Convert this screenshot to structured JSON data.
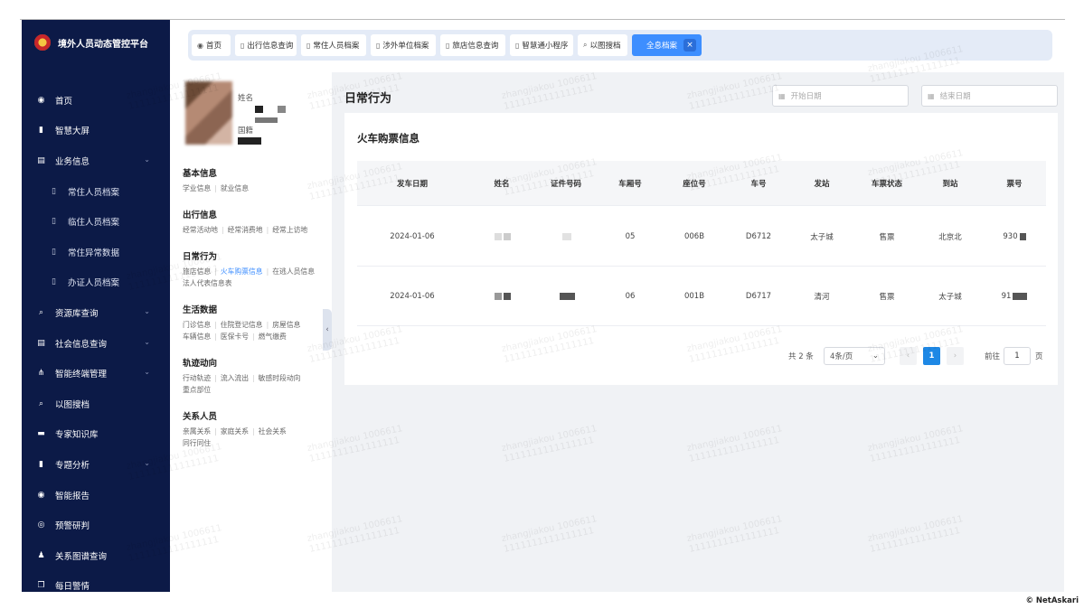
{
  "app": {
    "title": "境外人员动态管控平台"
  },
  "sidebar": {
    "items": [
      {
        "label": "首页",
        "icon": "dashboard-icon",
        "glyph": "◉",
        "sub": false,
        "caret": false
      },
      {
        "label": "智慧大屏",
        "icon": "bar-chart-icon",
        "glyph": "▮",
        "sub": false,
        "caret": false
      },
      {
        "label": "业务信息",
        "icon": "book-icon",
        "glyph": "▤",
        "sub": false,
        "caret": true
      },
      {
        "label": "常住人员档案",
        "icon": "book-icon",
        "glyph": "▯",
        "sub": true,
        "caret": false
      },
      {
        "label": "临住人员档案",
        "icon": "book-icon",
        "glyph": "▯",
        "sub": true,
        "caret": false
      },
      {
        "label": "常住异常数据",
        "icon": "book-icon",
        "glyph": "▯",
        "sub": true,
        "caret": false
      },
      {
        "label": "办证人员档案",
        "icon": "book-icon",
        "glyph": "▯",
        "sub": true,
        "caret": false
      },
      {
        "label": "资源库查询",
        "icon": "search-icon",
        "glyph": "⌕",
        "sub": false,
        "caret": true
      },
      {
        "label": "社会信息查询",
        "icon": "book-icon",
        "glyph": "▤",
        "sub": false,
        "caret": true
      },
      {
        "label": "智能终端管理",
        "icon": "network-icon",
        "glyph": "⋔",
        "sub": false,
        "caret": true
      },
      {
        "label": "以图搜档",
        "icon": "search-icon",
        "glyph": "⌕",
        "sub": false,
        "caret": false
      },
      {
        "label": "专家知识库",
        "icon": "message-icon",
        "glyph": "▬",
        "sub": false,
        "caret": false
      },
      {
        "label": "专题分析",
        "icon": "bar-chart-icon",
        "glyph": "▮",
        "sub": false,
        "caret": true
      },
      {
        "label": "智能报告",
        "icon": "dashboard-icon",
        "glyph": "◉",
        "sub": false,
        "caret": false
      },
      {
        "label": "预警研判",
        "icon": "target-icon",
        "glyph": "◎",
        "sub": false,
        "caret": false
      },
      {
        "label": "关系图谱查询",
        "icon": "users-icon",
        "glyph": "♟",
        "sub": false,
        "caret": false
      },
      {
        "label": "每日警情",
        "icon": "copy-icon",
        "glyph": "❐",
        "sub": false,
        "caret": false
      }
    ]
  },
  "tabs": [
    {
      "label": "首页",
      "icon": "dashboard-icon",
      "glyph": "◉"
    },
    {
      "label": "出行信息查询",
      "icon": "book-icon",
      "glyph": "▯"
    },
    {
      "label": "常住人员档案",
      "icon": "book-icon",
      "glyph": "▯"
    },
    {
      "label": "涉外单位档案",
      "icon": "book-icon",
      "glyph": "▯"
    },
    {
      "label": "旅店信息查询",
      "icon": "book-icon",
      "glyph": "▯"
    },
    {
      "label": "智慧通小程序",
      "icon": "book-icon",
      "glyph": "▯"
    },
    {
      "label": "以图搜档",
      "icon": "search-icon",
      "glyph": "⌕"
    },
    {
      "label": "全息档案",
      "icon": "",
      "glyph": "",
      "active": true,
      "close": "×"
    }
  ],
  "profile": {
    "name_label": "姓名",
    "country_label": "国籍",
    "sections": [
      {
        "title": "基本信息",
        "links": [
          [
            "学业信息",
            "就业信息"
          ]
        ]
      },
      {
        "title": "出行信息",
        "links": [
          [
            "经常活动地",
            "经常消费地",
            "经常上访地"
          ]
        ]
      },
      {
        "title": "日常行为",
        "links": [
          [
            "旅店信息",
            "火车购票信息",
            "在逃人员信息"
          ],
          [
            "法人代表信息表"
          ]
        ],
        "current": "火车购票信息"
      },
      {
        "title": "生活数据",
        "links": [
          [
            "门诊信息",
            "住院登记信息",
            "房屋信息"
          ],
          [
            "车辆信息",
            "医保卡号",
            "燃气缴费"
          ]
        ]
      },
      {
        "title": "轨迹动向",
        "links": [
          [
            "行动轨迹",
            "流入流出",
            "敏感时段动向"
          ],
          [
            "重点部位"
          ]
        ]
      },
      {
        "title": "关系人员",
        "links": [
          [
            "亲属关系",
            "家庭关系",
            "社会关系"
          ],
          [
            "同行同住"
          ]
        ]
      }
    ]
  },
  "main": {
    "title": "日常行为",
    "start_date_placeholder": "开始日期",
    "end_date_placeholder": "结束日期",
    "card_title": "火车购票信息",
    "columns": [
      "发车日期",
      "姓名",
      "证件号码",
      "车厢号",
      "座位号",
      "车号",
      "发站",
      "车票状态",
      "到站",
      "票号"
    ],
    "rows": [
      {
        "date": "2024-01-06",
        "carriage": "05",
        "seat": "006B",
        "train": "D6712",
        "from": "太子城",
        "status": "售票",
        "to": "北京北",
        "ticket": "930"
      },
      {
        "date": "2024-01-06",
        "carriage": "06",
        "seat": "001B",
        "train": "D6717",
        "from": "清河",
        "status": "售票",
        "to": "太子城",
        "ticket": "91"
      }
    ],
    "pagination": {
      "total": "共 2 条",
      "page_size": "4条/页",
      "current": "1",
      "goto_label": "前往",
      "goto_value": "1",
      "page_suffix": "页",
      "prev": "‹",
      "next": "›",
      "dropdown": "⌄"
    }
  },
  "watermark": {
    "line1": "zhangjiakou 1006611",
    "line2": "1111111111111111"
  },
  "credit": "© NetAskari",
  "colors": {
    "sidebar": "#0c1a47",
    "accent": "#3d8eff",
    "tabbar": "#e4ebf7",
    "page": "#f0f2f5"
  }
}
